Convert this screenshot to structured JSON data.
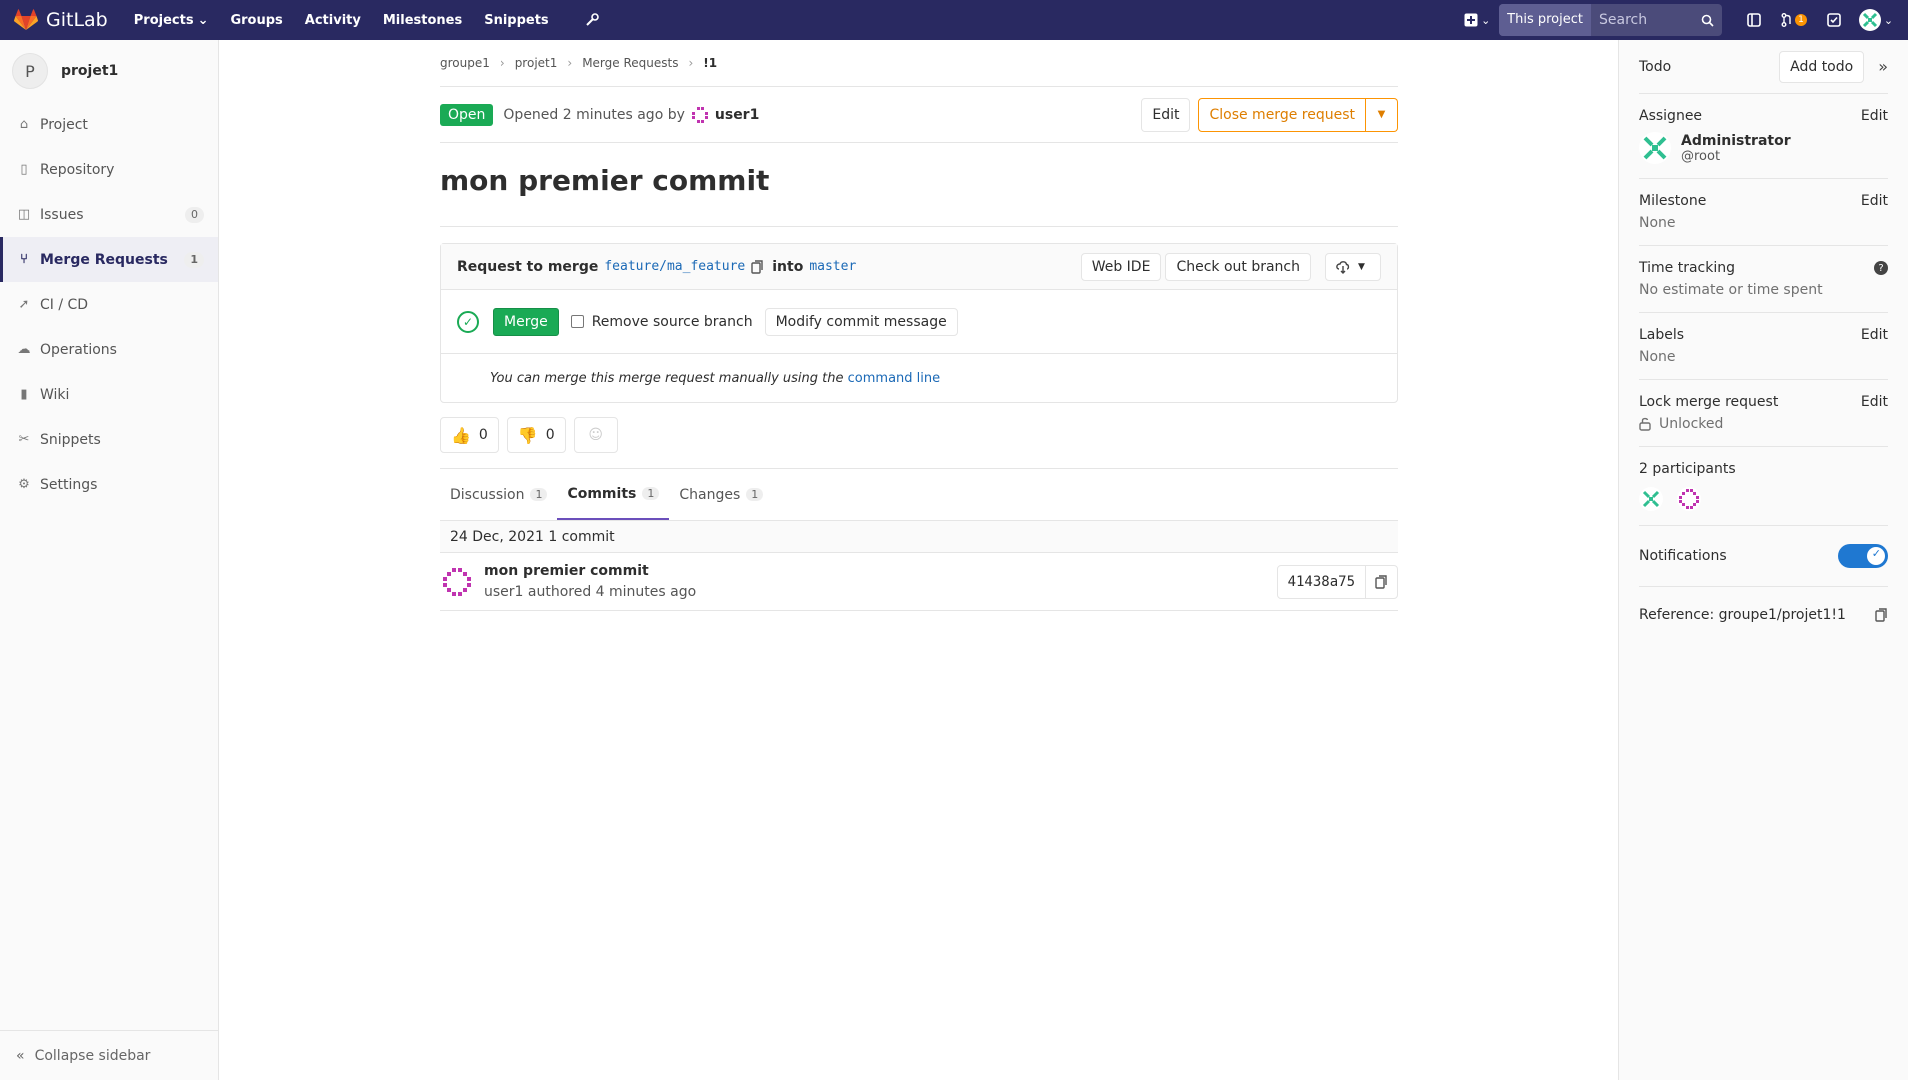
{
  "topnav": {
    "brand": "GitLab",
    "links": [
      "Projects",
      "Groups",
      "Activity",
      "Milestones",
      "Snippets"
    ],
    "search_scope": "This project",
    "search_placeholder": "Search",
    "mr_badge": "1",
    "colors": {
      "bar": "#292961",
      "badge": "#fc9403"
    }
  },
  "leftbar": {
    "project_initial": "P",
    "project_name": "projet1",
    "items": [
      {
        "label": "Project",
        "icon": "home-icon"
      },
      {
        "label": "Repository",
        "icon": "book-icon"
      },
      {
        "label": "Issues",
        "icon": "issues-icon",
        "count": "0"
      },
      {
        "label": "Merge Requests",
        "icon": "merge-request-icon",
        "count": "1",
        "active": true
      },
      {
        "label": "CI / CD",
        "icon": "rocket-icon"
      },
      {
        "label": "Operations",
        "icon": "cloud-icon"
      },
      {
        "label": "Wiki",
        "icon": "book-icon"
      },
      {
        "label": "Snippets",
        "icon": "scissors-icon"
      },
      {
        "label": "Settings",
        "icon": "gear-icon"
      }
    ],
    "collapse_label": "Collapse sidebar"
  },
  "breadcrumb": [
    "groupe1",
    "projet1",
    "Merge Requests",
    "!1"
  ],
  "mr": {
    "status": "Open",
    "opened_text": "Opened 2 minutes ago by",
    "author": "user1",
    "edit_label": "Edit",
    "close_label": "Close merge request",
    "title": "mon premier commit"
  },
  "widget": {
    "request_label": "Request to merge",
    "source_branch": "feature/ma_feature",
    "into_label": "into",
    "target_branch": "master",
    "web_ide_label": "Web IDE",
    "checkout_label": "Check out branch",
    "merge_label": "Merge",
    "remove_source_label": "Remove source branch",
    "modify_label": "Modify commit message",
    "manual_text": "You can merge this merge request manually using the",
    "command_line_link": "command line"
  },
  "awards": {
    "thumbs_up": "0",
    "thumbs_down": "0"
  },
  "tabs": [
    {
      "label": "Discussion",
      "count": "1"
    },
    {
      "label": "Commits",
      "count": "1",
      "active": true
    },
    {
      "label": "Changes",
      "count": "1"
    }
  ],
  "commits": {
    "day": "24 Dec, 2021",
    "day_count": "1 commit",
    "items": [
      {
        "title": "mon premier commit",
        "subtitle": "user1 authored 4 minutes ago",
        "sha": "41438a75"
      }
    ]
  },
  "rightbar": {
    "todo_label": "Todo",
    "add_todo_label": "Add todo",
    "assignee_label": "Assignee",
    "edit": "Edit",
    "assignee_name": "Administrator",
    "assignee_user": "@root",
    "milestone_label": "Milestone",
    "milestone_value": "None",
    "time_tracking_label": "Time tracking",
    "time_tracking_value": "No estimate or time spent",
    "labels_label": "Labels",
    "labels_value": "None",
    "lock_label": "Lock merge request",
    "lock_value": "Unlocked",
    "participants_label": "2 participants",
    "notifications_label": "Notifications",
    "reference_label": "Reference: groupe1/projet1!1"
  }
}
